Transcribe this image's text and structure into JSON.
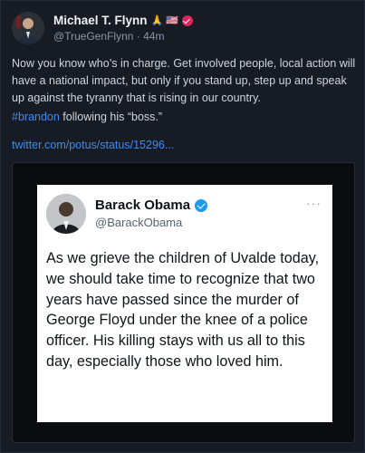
{
  "post": {
    "author_name": "Michael T. Flynn",
    "author_emoji": "🙏 🇺🇸",
    "handle": "@TrueGenFlynn",
    "separator": "·",
    "time": "44m",
    "body": "Now you know who’s in charge. Get involved people, local action will have a national impact, but only if you stand up, step up and speak up against the tyranny that is rising in our country.",
    "hashtag": "#brandon",
    "second_line": " following his “boss.”",
    "link": "twitter.com/potus/status/15296..."
  },
  "embedded_tweet": {
    "name": "Barack Obama",
    "handle": "@BarackObama",
    "more": "···",
    "text": "As we grieve the children of Uvalde today, we should take time to recognize that two years have passed since the murder of George Floyd under the knee of a police officer. His killing stays with us all to this day, especially those who loved him."
  },
  "colors": {
    "background": "#161b24",
    "link": "#3d8bf0",
    "verified_blue": "#1d9bf0",
    "badge_pink": "#e0245e"
  }
}
